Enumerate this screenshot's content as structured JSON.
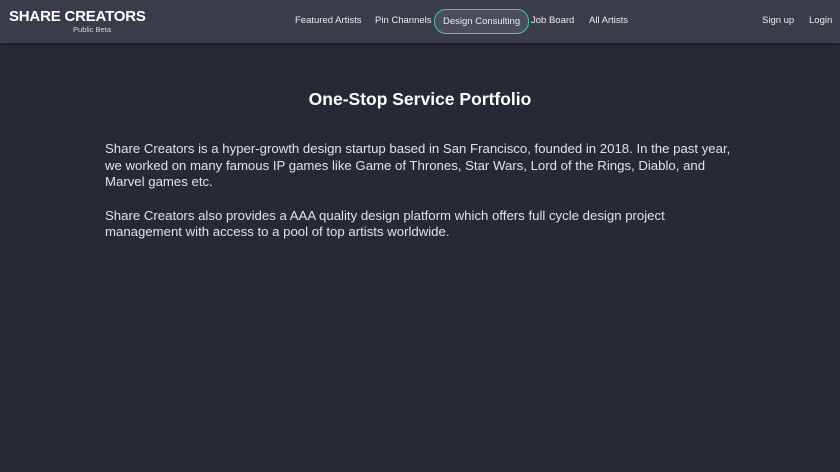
{
  "brand": {
    "name": "SHARE CREATORS",
    "subtitle": "Public Beta"
  },
  "nav": {
    "featured_artists": "Featured Artists",
    "pin_channels": "Pin Channels",
    "design_consulting": "Design Consulting",
    "job_board": "Job Board",
    "all_artists": "All Artists",
    "sign_up": "Sign up",
    "login": "Login"
  },
  "colors": {
    "background": "#272935",
    "navbar": "#3a3d49",
    "active_border": "#4fc1a8"
  },
  "main": {
    "title": "One-Stop Service Portfolio",
    "paragraphs": [
      "Share Creators is a hyper-growth design startup based in San Francisco, founded in 2018. In the past year, we worked on many famous IP games like Game of Thrones, Star Wars, Lord of the Rings, Diablo, and Marvel games etc.",
      "Share Creators also provides a AAA quality design platform which offers full cycle design project management with access to a pool of top artists worldwide."
    ]
  }
}
